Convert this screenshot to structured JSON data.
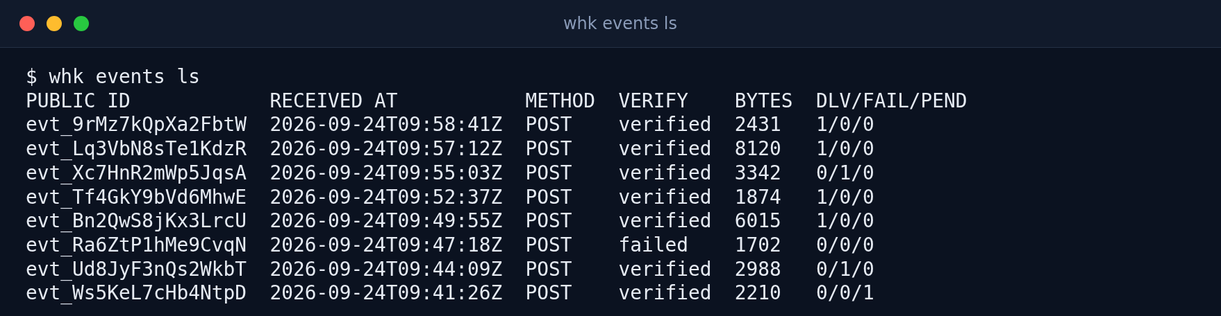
{
  "window": {
    "title": "whk events ls"
  },
  "terminal": {
    "command": "$ whk events ls",
    "header": "PUBLIC ID            RECEIVED AT           METHOD  VERIFY    BYTES  DLV/FAIL/PEND",
    "lines": [
      "evt_9rMz7kQpXa2FbtW  2026-09-24T09:58:41Z  POST    verified  2431   1/0/0",
      "evt_Lq3VbN8sTe1KdzR  2026-09-24T09:57:12Z  POST    verified  8120   1/0/0",
      "evt_Xc7HnR2mWp5JqsA  2026-09-24T09:55:03Z  POST    verified  3342   0/1/0",
      "evt_Tf4GkY9bVd6MhwE  2026-09-24T09:52:37Z  POST    verified  1874   1/0/0",
      "evt_Bn2QwS8jKx3LrcU  2026-09-24T09:49:55Z  POST    verified  6015   1/0/0",
      "evt_Ra6ZtP1hMe9CvqN  2026-09-24T09:47:18Z  POST    failed    1702   0/0/0",
      "evt_Ud8JyF3nQs2WkbT  2026-09-24T09:44:09Z  POST    verified  2988   0/1/0",
      "evt_Ws5KeL7cHb4NtpD  2026-09-24T09:41:26Z  POST    verified  2210   0/0/1"
    ]
  }
}
